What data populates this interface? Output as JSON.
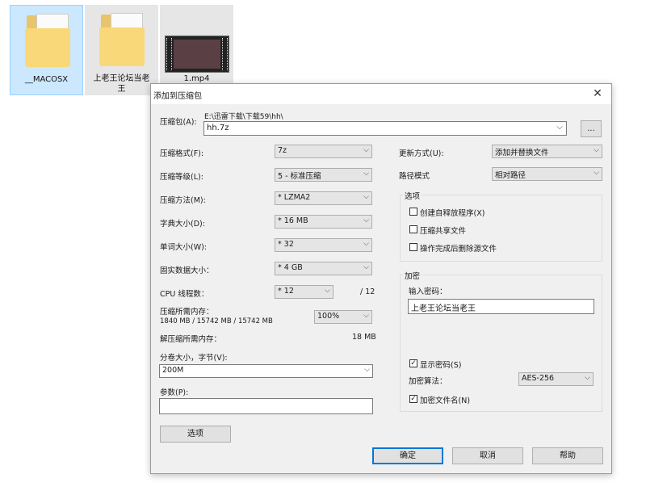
{
  "desktop": {
    "files": [
      {
        "name": "__MACOSX"
      },
      {
        "name": "上老王论坛当老\n王"
      },
      {
        "name": "1.mp4"
      }
    ]
  },
  "dialog": {
    "title": "添加到压缩包",
    "archive_label": "压缩包(A):",
    "archive_path": "E:\\迅雷下载\\下载59\\hh\\",
    "archive_name": "hh.7z",
    "browse_label": "...",
    "format_label": "压缩格式(F):",
    "format_value": "7z",
    "level_label": "压缩等级(L):",
    "level_value": "5 - 标准压缩",
    "method_label": "压缩方法(M):",
    "method_value": "* LZMA2",
    "dict_label": "字典大小(D):",
    "dict_value": "* 16 MB",
    "word_label": "单词大小(W):",
    "word_value": "* 32",
    "solid_label": "固实数据大小：",
    "solid_value": "* 4 GB",
    "cpu_label": "CPU 线程数：",
    "cpu_value": "* 12",
    "cpu_total": "/ 12",
    "mem_label": "压缩所需内存：",
    "mem_detail": "1840 MB / 15742 MB / 15742 MB",
    "mem_percent": "100%",
    "decomp_label": "解压缩所需内存：",
    "decomp_value": "18 MB",
    "split_label": "分卷大小，字节(V):",
    "split_value": "200M",
    "params_label": "参数(P):",
    "params_value": "",
    "options_button": "选项",
    "update_label": "更新方式(U):",
    "update_value": "添加并替换文件",
    "path_label": "路径模式",
    "path_value": "相对路径",
    "options_group": "选项",
    "opt_sfx": "创建自释放程序(X)",
    "opt_shared": "压缩共享文件",
    "opt_delete": "操作完成后删除源文件",
    "encrypt_group": "加密",
    "password_label": "输入密码：",
    "password_value": "上老王论坛当老王",
    "show_password": "显示密码(S)",
    "enc_method_label": "加密算法：",
    "enc_method_value": "AES-256",
    "encrypt_names": "加密文件名(N)",
    "ok": "确定",
    "cancel": "取消",
    "help": "帮助"
  },
  "icons": {
    "close": "close-icon",
    "dropdown": "chevron-down-icon",
    "checked": "checkmark-icon"
  }
}
